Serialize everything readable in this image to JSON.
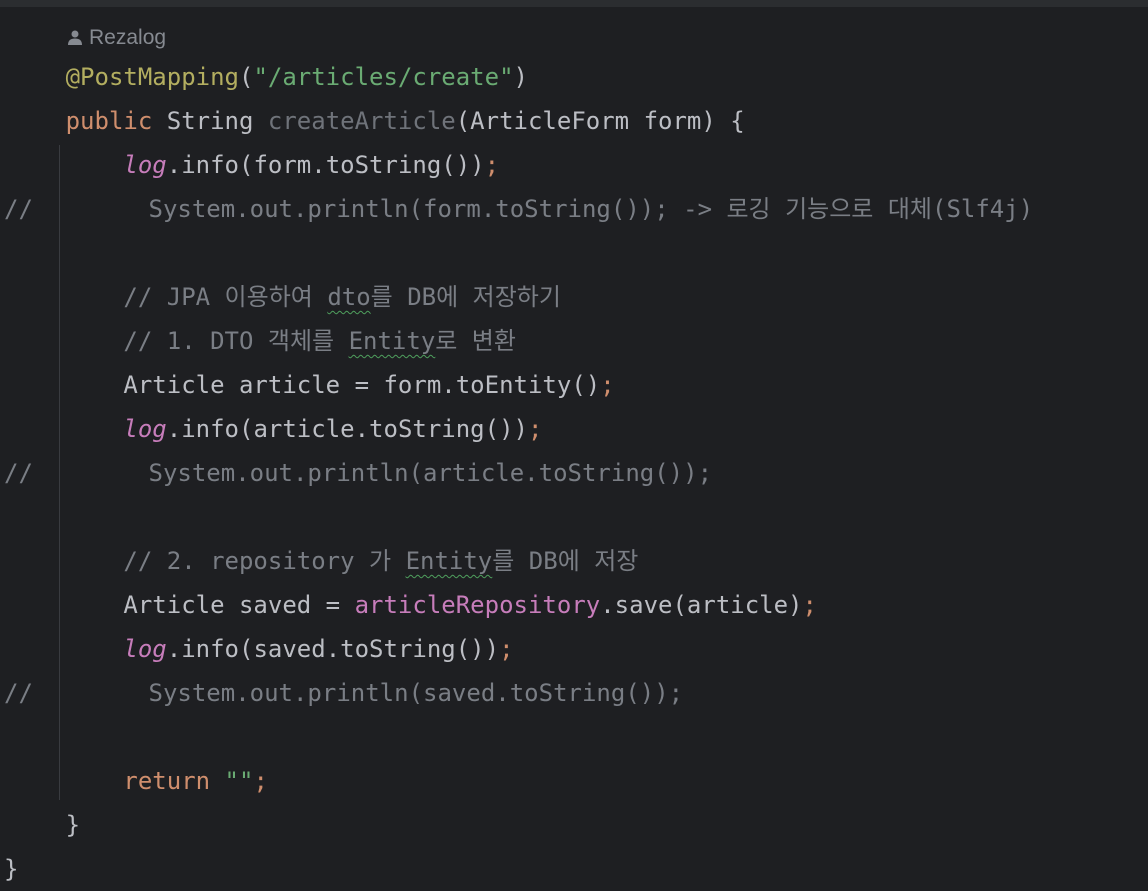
{
  "editor": {
    "author": "Rezalog",
    "lines": [
      {
        "tokens": [
          {
            "text": "@PostMapping",
            "kind": "ann"
          },
          {
            "text": "(",
            "kind": "default"
          },
          {
            "text": "\"/articles/create\"",
            "kind": "str"
          },
          {
            "text": ")",
            "kind": "default"
          }
        ]
      },
      {
        "tokens": [
          {
            "text": "public",
            "kind": "kw"
          },
          {
            "text": " String ",
            "kind": "default"
          },
          {
            "text": "createArticle",
            "kind": "method-decl"
          },
          {
            "text": "(ArticleForm form) {",
            "kind": "default"
          }
        ]
      },
      {
        "tokens": [
          {
            "text": "    ",
            "kind": "default"
          },
          {
            "text": "log",
            "kind": "field-italic"
          },
          {
            "text": ".info(form.toString())",
            "kind": "default"
          },
          {
            "text": ";",
            "kind": "kw"
          }
        ]
      },
      {
        "tokens": [
          {
            "text": "//        System.out.println(form.toString()); -> 로깅 기능으로 대체(Slf4j)",
            "kind": "comment"
          }
        ]
      },
      {
        "tokens": []
      },
      {
        "tokens": [
          {
            "text": "    // JPA 이용하여 ",
            "kind": "comment"
          },
          {
            "text": "dto",
            "kind": "comment-typo"
          },
          {
            "text": "를 DB에 저장하기",
            "kind": "comment"
          }
        ]
      },
      {
        "tokens": [
          {
            "text": "    // 1. DTO 객체를 ",
            "kind": "comment"
          },
          {
            "text": "Entity",
            "kind": "comment-typo"
          },
          {
            "text": "로 변환",
            "kind": "comment"
          }
        ]
      },
      {
        "tokens": [
          {
            "text": "    Article article = form.toEntity()",
            "kind": "default"
          },
          {
            "text": ";",
            "kind": "kw"
          }
        ]
      },
      {
        "tokens": [
          {
            "text": "    ",
            "kind": "default"
          },
          {
            "text": "log",
            "kind": "field-italic"
          },
          {
            "text": ".info(article.toString())",
            "kind": "default"
          },
          {
            "text": ";",
            "kind": "kw"
          }
        ]
      },
      {
        "tokens": [
          {
            "text": "//        System.out.println(article.toString());",
            "kind": "comment"
          }
        ]
      },
      {
        "tokens": []
      },
      {
        "tokens": [
          {
            "text": "    // 2. repository 가 ",
            "kind": "comment"
          },
          {
            "text": "Entity",
            "kind": "comment-typo"
          },
          {
            "text": "를 DB에 저장",
            "kind": "comment"
          }
        ]
      },
      {
        "tokens": [
          {
            "text": "    Article saved = ",
            "kind": "default"
          },
          {
            "text": "articleRepository",
            "kind": "field"
          },
          {
            "text": ".save(article)",
            "kind": "default"
          },
          {
            "text": ";",
            "kind": "kw"
          }
        ]
      },
      {
        "tokens": [
          {
            "text": "    ",
            "kind": "default"
          },
          {
            "text": "log",
            "kind": "field-italic"
          },
          {
            "text": ".info(saved.toString())",
            "kind": "default"
          },
          {
            "text": ";",
            "kind": "kw"
          }
        ]
      },
      {
        "tokens": [
          {
            "text": "//        System.out.println(saved.toString());",
            "kind": "comment"
          }
        ]
      },
      {
        "tokens": []
      },
      {
        "tokens": [
          {
            "text": "    ",
            "kind": "default"
          },
          {
            "text": "return",
            "kind": "kw"
          },
          {
            "text": " ",
            "kind": "default"
          },
          {
            "text": "\"\"",
            "kind": "str"
          },
          {
            "text": ";",
            "kind": "kw"
          }
        ]
      },
      {
        "tokens": [
          {
            "text": "}",
            "kind": "default"
          }
        ]
      },
      {
        "tokens": [
          {
            "text": "}",
            "kind": "default"
          }
        ]
      }
    ]
  }
}
